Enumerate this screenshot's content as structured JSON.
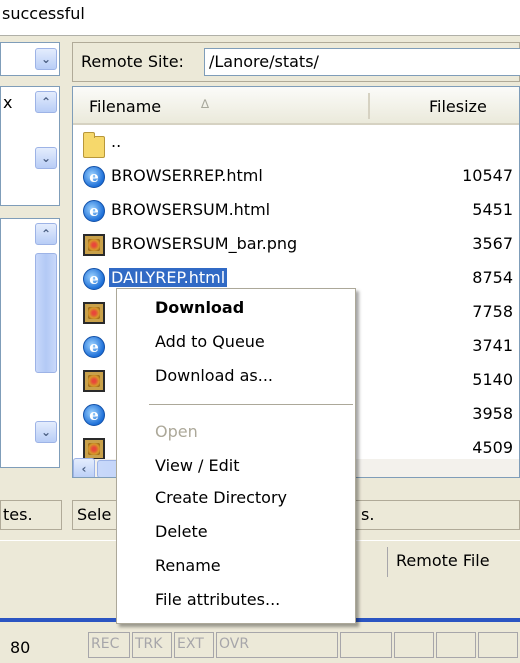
{
  "log": {
    "text": "successful"
  },
  "remote_site": {
    "label": "Remote Site:",
    "path": "/Lanore/stats/"
  },
  "file_list": {
    "columns": {
      "filename": "Filename",
      "sort_indicator": "∆",
      "filesize": "Filesize"
    },
    "rows": [
      {
        "icon": "folder-icon",
        "name": "..",
        "size": ""
      },
      {
        "icon": "ie-html-icon",
        "name": "BROWSERREP.html",
        "size": "10547"
      },
      {
        "icon": "ie-html-icon",
        "name": "BROWSERSUM.html",
        "size": "5451"
      },
      {
        "icon": "png-image-icon",
        "name": "BROWSERSUM_bar.png",
        "size": "3567"
      },
      {
        "icon": "ie-html-icon",
        "name": "DAILYREP.html",
        "size": "8754",
        "selected": true
      },
      {
        "icon": "png-image-icon",
        "name": "",
        "size": "7758"
      },
      {
        "icon": "ie-html-icon",
        "name": "",
        "size": "3741"
      },
      {
        "icon": "png-image-icon",
        "name": "",
        "size": "5140"
      },
      {
        "icon": "ie-html-icon",
        "name": "",
        "size": "3958"
      },
      {
        "icon": "png-image-icon",
        "name": "",
        "size": "4509"
      }
    ]
  },
  "left_pane": {
    "x_label": "x",
    "status_text": "tes."
  },
  "remote_status": {
    "text": "Sele",
    "tail": "s."
  },
  "queue_tabs": {
    "remote_files": "Remote File"
  },
  "statusbar": {
    "left_value": "80",
    "indicators": [
      "REC",
      "TRK",
      "EXT",
      "OVR"
    ]
  },
  "context_menu": {
    "items": [
      {
        "label": "Download",
        "bold": true,
        "enabled": true
      },
      {
        "label": "Add to Queue",
        "bold": false,
        "enabled": true
      },
      {
        "label": "Download as...",
        "bold": false,
        "enabled": true
      },
      {
        "label": "Open",
        "bold": false,
        "enabled": false
      },
      {
        "label": "View / Edit",
        "bold": false,
        "enabled": true
      },
      {
        "label": "Create Directory",
        "bold": false,
        "enabled": true
      },
      {
        "label": "Delete",
        "bold": false,
        "enabled": true
      },
      {
        "label": "Rename",
        "bold": false,
        "enabled": true
      },
      {
        "label": "File attributes...",
        "bold": false,
        "enabled": true
      }
    ]
  },
  "colors": {
    "selection": "#316AC5",
    "window_face": "#ECE9D8",
    "xp_blue": "#2B55C2"
  }
}
